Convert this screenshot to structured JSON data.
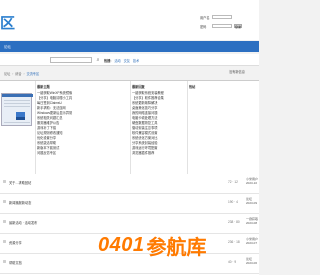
{
  "header": {
    "logo_text": "区",
    "login": {
      "username_label": "用户名",
      "password_label": "密码",
      "login_button": "登录"
    }
  },
  "nav": {
    "home": "论坛"
  },
  "search": {
    "button_icon": "search-icon",
    "hot_label": "热搜:",
    "hot_keywords": [
      "活动",
      "交友",
      "技术"
    ]
  },
  "breadcrumb": {
    "items": [
      "论坛",
      "综合",
      "交流专区"
    ],
    "new_message": "没有新信息"
  },
  "forum": {
    "col1_title": "最新主题",
    "col2_title": "最新回复",
    "col3_title": "热帖",
    "col1_items": [
      "一键获取WinXP系统镜像",
      "【分享】电脑清理小工具",
      "每日签到ClaimsU",
      "新手求助：无法连网",
      "Windows更新后显示异常",
      "系统相关问题汇总",
      "服务器维护公告",
      "游戏补丁下载",
      "论坛规则修改通知",
      "优化设置分享",
      "系统激活帮助",
      "新版本下载测试",
      "问题反馈专区"
    ],
    "col2_items": [
      "一键获取系统安装教程",
      "【分享】软件推荐合集",
      "系统更新故障解决",
      "桌面美化技巧分享",
      "我的网络连接问题",
      "电脑卡顿处理方法",
      "硬盘数据恢复工具",
      "驱动安装注意事项",
      "软件兼容模式设置",
      "系统优化方案对比",
      "分享系统封装经验",
      "游戏运行环境配置",
      "浏览器插件推荐"
    ]
  },
  "threads": [
    {
      "title": "关于…求助回帖",
      "count": "72 · 12",
      "last": [
        "小米用户",
        "2023-10"
      ]
    },
    {
      "title": "新闻播报新动态",
      "count": "190 · 4",
      "last": [
        "论坛",
        "2023-09"
      ]
    },
    {
      "title": "最新活动 · 活动发布",
      "count": "238 · 80",
      "last": [
        "一键获取",
        "2023-08"
      ]
    },
    {
      "title": "资源分享",
      "count": "236 · 18",
      "last": [
        "小米用户",
        "2023-07"
      ]
    },
    {
      "title": "帮助文档",
      "count": "40 · 9",
      "last": [
        "论坛",
        "2023-06"
      ]
    }
  ],
  "watermark": {
    "brand_code": "0401",
    "brand_name": "参航库"
  }
}
